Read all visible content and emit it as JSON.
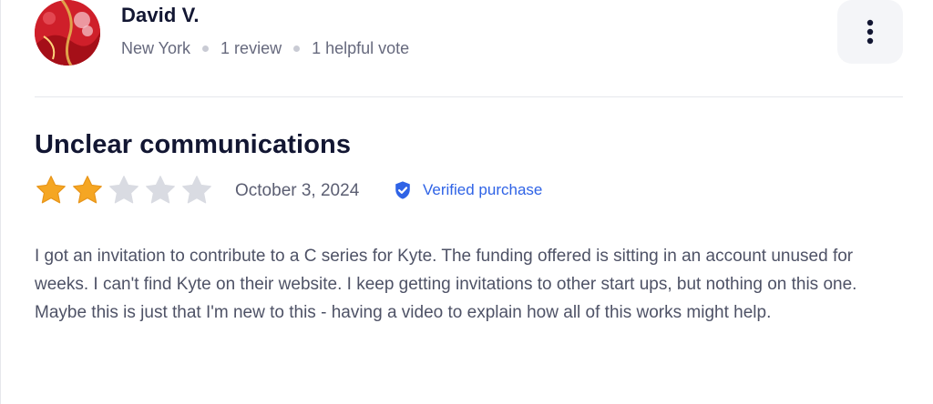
{
  "reviewer": {
    "name": "David V.",
    "location": "New York",
    "review_count": "1 review",
    "helpful_votes": "1 helpful vote"
  },
  "review": {
    "title": "Unclear communications",
    "rating": 2,
    "max_rating": 5,
    "date": "October 3, 2024",
    "verified_label": "Verified purchase",
    "body": "I got an invitation to contribute to a C series for Kyte. The funding offered is sitting in an account unused for weeks. I can't find Kyte on their website. I keep getting invitations to other start ups, but nothing on this one. Maybe this is just that I'm new to this - having a video to explain how all of this works might help."
  },
  "icons": {
    "more": "more-vertical-icon",
    "verified": "shield-check-icon",
    "star": "star-icon"
  },
  "colors": {
    "star_filled": "#f5a623",
    "star_empty": "#d9dbe2",
    "verified_blue": "#2f63e6",
    "text_dark": "#121632",
    "text_muted": "#66697d"
  }
}
